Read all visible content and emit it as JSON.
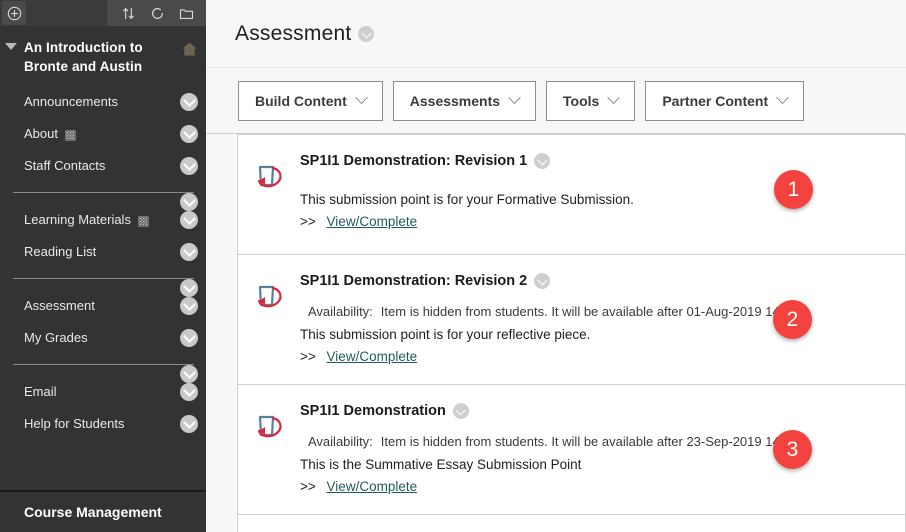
{
  "sidebar": {
    "toolbar": {
      "left_icon": "add-circle-icon",
      "right_icons": [
        "sort-updown-icon",
        "refresh-icon",
        "folder-icon"
      ]
    },
    "course_title": "An Introduction to Bronte and Austin",
    "home_icon": "home-icon",
    "items": [
      {
        "label": "Announcements",
        "mini_icon": null,
        "type": "link"
      },
      {
        "label": "About",
        "mini_icon": "grid-icon",
        "type": "link"
      },
      {
        "label": "Staff Contacts",
        "mini_icon": null,
        "type": "link"
      },
      {
        "label": "",
        "mini_icon": null,
        "type": "separator"
      },
      {
        "label": "Learning Materials",
        "mini_icon": "grid-icon",
        "type": "link"
      },
      {
        "label": "Reading List",
        "mini_icon": null,
        "type": "link"
      },
      {
        "label": "",
        "mini_icon": null,
        "type": "separator"
      },
      {
        "label": "Assessment",
        "mini_icon": null,
        "type": "link"
      },
      {
        "label": "My Grades",
        "mini_icon": null,
        "type": "link"
      },
      {
        "label": "",
        "mini_icon": null,
        "type": "separator"
      },
      {
        "label": "Email",
        "mini_icon": null,
        "type": "link"
      },
      {
        "label": "Help for Students",
        "mini_icon": null,
        "type": "link"
      }
    ],
    "course_management": "Course Management"
  },
  "main": {
    "page_title": "Assessment",
    "page_title_menu_icon": "chevron-down-circle-icon",
    "action_buttons": [
      {
        "label": "Build Content"
      },
      {
        "label": "Assessments"
      },
      {
        "label": "Tools"
      },
      {
        "label": "Partner Content"
      }
    ],
    "items": [
      {
        "badge": "1",
        "icon": "turnitin-icon",
        "title": "SP1I1 Demonstration: Revision 1",
        "availability_label": "",
        "availability_text": "",
        "description": "This submission point is for your Formative Submission.",
        "link_prefix": ">>",
        "link_label": "View/Complete"
      },
      {
        "badge": "2",
        "icon": "turnitin-icon",
        "title": "SP1I1 Demonstration: Revision 2",
        "availability_label": "Availability:",
        "availability_text": "Item is hidden from students. It will be available after 01-Aug-2019 14:46.",
        "description": "This submission point is for your reflective piece.",
        "link_prefix": ">>",
        "link_label": "View/Complete"
      },
      {
        "badge": "3",
        "icon": "turnitin-icon",
        "title": "SP1I1 Demonstration",
        "availability_label": "Availability:",
        "availability_text": "Item is hidden from students. It will be available after 23-Sep-2019 14:00.",
        "description": "This is the Summative Essay Submission Point",
        "link_prefix": ">>",
        "link_label": "View/Complete"
      }
    ]
  },
  "colors": {
    "badge": "#F4433F",
    "sidebar_bg": "#333333",
    "link": "#1F5B5B",
    "accent_red": "#D9283C"
  }
}
